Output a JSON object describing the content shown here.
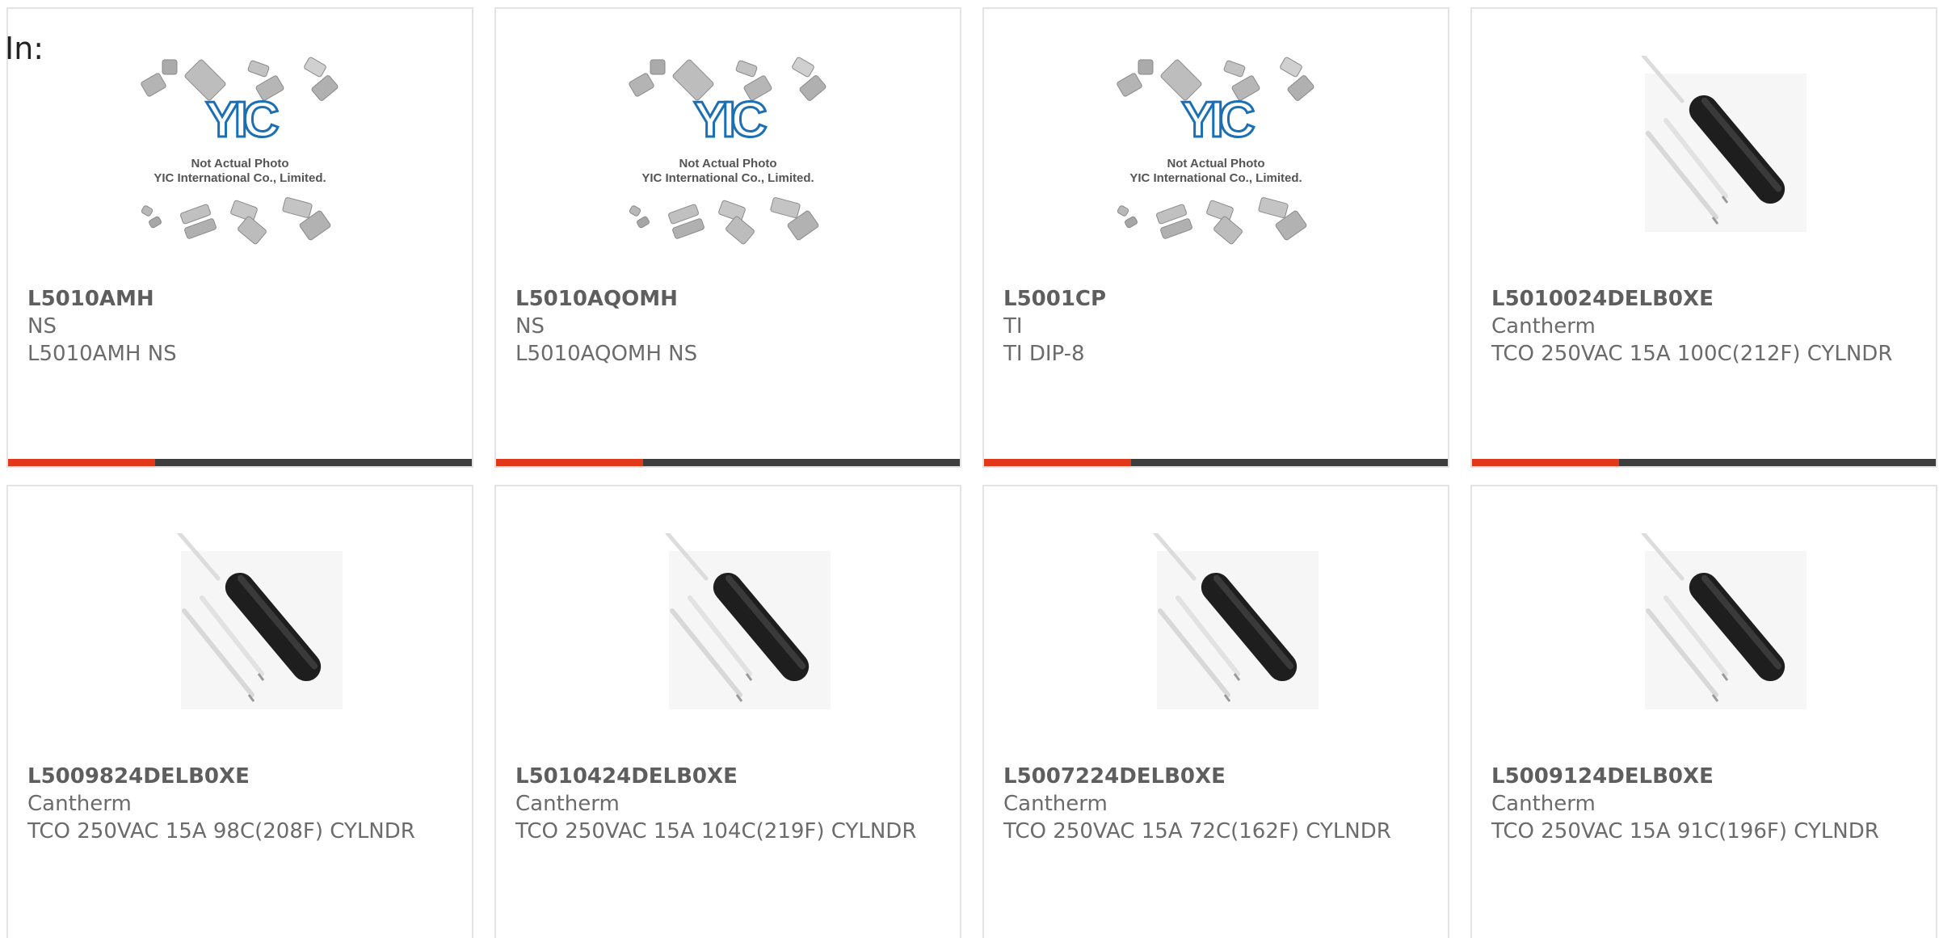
{
  "filter_label": "In:",
  "placeholder": {
    "logo_text": "YIC",
    "line1": "Not Actual Photo",
    "line2": "YIC International Co., Limited."
  },
  "colors": {
    "accent": "#e2381a",
    "bar": "#3d3d3d",
    "border": "#e3e3e3",
    "logo": "#1a6fb5"
  },
  "products": [
    {
      "part": "L5010AMH",
      "brand": "NS",
      "desc": "L5010AMH NS",
      "image": "placeholder"
    },
    {
      "part": "L5010AQOMH",
      "brand": "NS",
      "desc": "L5010AQOMH NS",
      "image": "placeholder"
    },
    {
      "part": "L5001CP",
      "brand": "TI",
      "desc": "TI DIP-8",
      "image": "placeholder"
    },
    {
      "part": "L5010024DELB0XE",
      "brand": "Cantherm",
      "desc": "TCO 250VAC 15A 100C(212F) CYLNDR",
      "image": "thermal-cutoff"
    },
    {
      "part": "L5009824DELB0XE",
      "brand": "Cantherm",
      "desc": "TCO 250VAC 15A 98C(208F) CYLNDR",
      "image": "thermal-cutoff"
    },
    {
      "part": "L5010424DELB0XE",
      "brand": "Cantherm",
      "desc": "TCO 250VAC 15A 104C(219F) CYLNDR",
      "image": "thermal-cutoff"
    },
    {
      "part": "L5007224DELB0XE",
      "brand": "Cantherm",
      "desc": "TCO 250VAC 15A 72C(162F) CYLNDR",
      "image": "thermal-cutoff"
    },
    {
      "part": "L5009124DELB0XE",
      "brand": "Cantherm",
      "desc": "TCO 250VAC 15A 91C(196F) CYLNDR",
      "image": "thermal-cutoff"
    }
  ]
}
